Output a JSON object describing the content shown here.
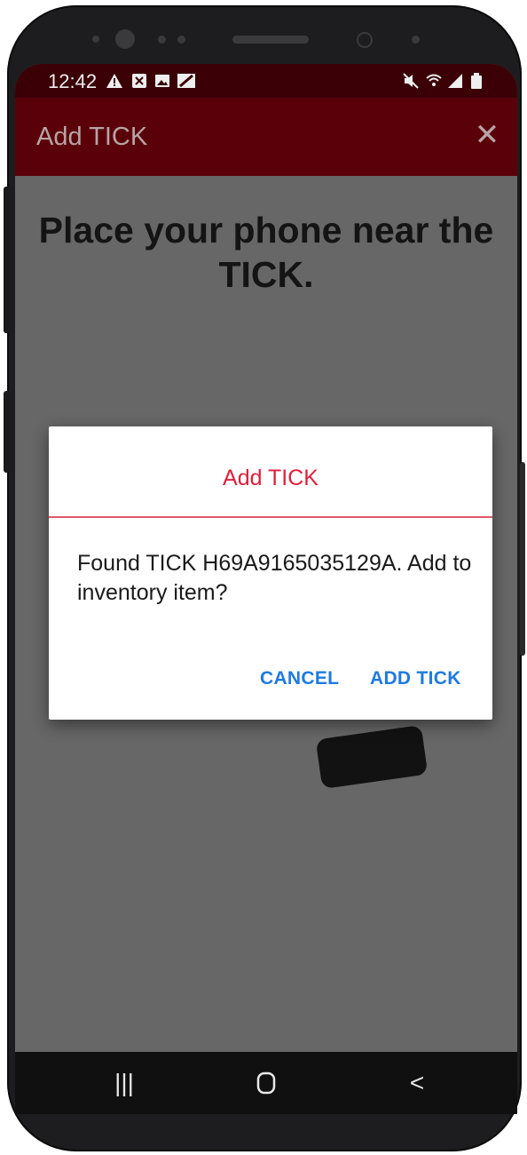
{
  "status_bar": {
    "time": "12:42",
    "icons_left": [
      "warning-icon",
      "close-box-icon",
      "image-icon",
      "edit-icon"
    ],
    "icons_right": [
      "mute-icon",
      "wifi-icon",
      "signal-icon",
      "battery-icon"
    ]
  },
  "app_bar": {
    "title": "Add TICK",
    "close_glyph": "✕"
  },
  "main": {
    "heading": "Place your phone near the TICK."
  },
  "dialog": {
    "title": "Add TICK",
    "message": "Found TICK H69A9165035129A. Add to inventory item?",
    "cancel_label": "CANCEL",
    "confirm_label": "ADD TICK"
  },
  "nav_bar": {
    "recents_glyph": "|||",
    "home_glyph": "▢",
    "back_glyph": "<"
  },
  "colors": {
    "status_bar_bg": "#3a0006",
    "app_bar_bg": "#5a0009",
    "dialog_accent": "#e0203a",
    "button_text": "#1f7ae0",
    "scrim_bg": "#676767"
  }
}
